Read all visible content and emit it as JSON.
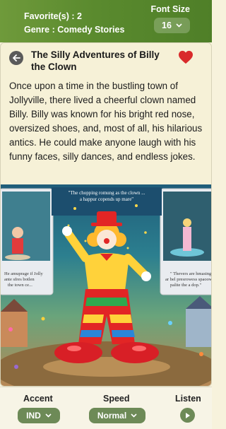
{
  "header": {
    "favorites": "Favorite(s) : 2",
    "genre": "Genre : Comedy Stories",
    "font_size_label": "Font Size",
    "font_size_value": "16"
  },
  "story": {
    "title": "The Silly Adventures of Billy the Clown",
    "text": "Once upon a time in the bustling town of Jollyville, there lived a cheerful clown named Billy. Billy was known for his bright red nose, oversized shoes, and, most of all, his hilarious antics. He could make anyone laugh with his funny faces, silly dances, and endless jokes.",
    "favorited": true
  },
  "illustration": {
    "caption_top": "\"The chopping romung as the clown ... a happur copends up mare\"",
    "caption_left": "He amuprage if Jolly ante sfres botlen the town ce...",
    "caption_right": "\" Thevers are hmasing ar bel presrowess spaoow palite the a dop.\""
  },
  "footer": {
    "accent_label": "Accent",
    "accent_value": "IND",
    "speed_label": "Speed",
    "speed_value": "Normal",
    "listen_label": "Listen"
  },
  "colors": {
    "header_green": "#5a8a2e",
    "pill_green": "#6d8a57",
    "heart_red": "#d92b2b",
    "background_cream": "#f6f1d7"
  }
}
